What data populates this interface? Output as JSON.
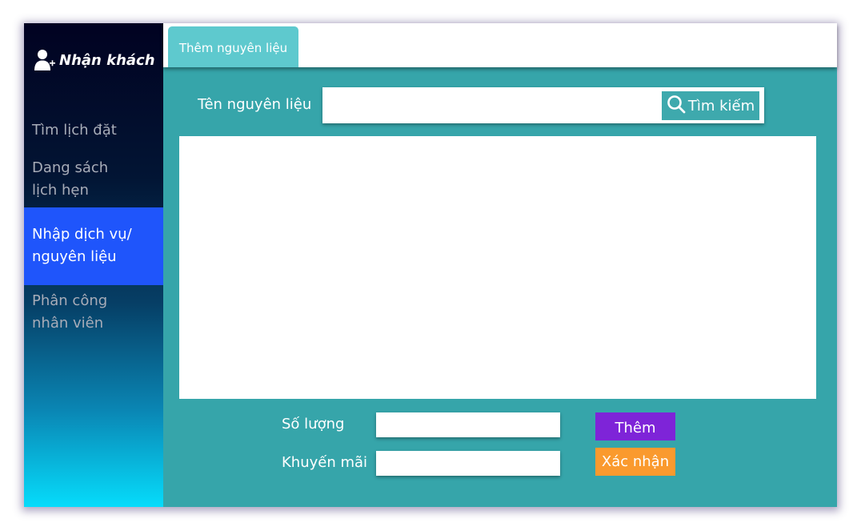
{
  "sidebar": {
    "brand_label": "Nhận khách",
    "brand_icon": "add-user-icon",
    "items": [
      {
        "label": "Tìm lịch đặt"
      },
      {
        "line1": "Dang sách",
        "line2": "lịch hẹn"
      },
      {
        "line1": "Nhập dịch vụ/",
        "line2": "nguyên liệu",
        "active": true
      },
      {
        "line1": "Phân công",
        "line2": "nhân viên"
      }
    ]
  },
  "tabs": [
    {
      "label": "Thêm nguyên liệu",
      "active": true
    }
  ],
  "search": {
    "label": "Tên nguyên liệu",
    "value": "",
    "button_label": "Tìm kiếm",
    "button_icon": "search-icon"
  },
  "form": {
    "quantity_label": "Số lượng",
    "quantity_value": "",
    "promo_label": "Khuyến mãi",
    "promo_value": "",
    "add_label": "Thêm",
    "confirm_label": "Xác nhận"
  },
  "colors": {
    "content_bg": "#36a5aa",
    "active_nav": "#1f55fb",
    "tab": "#5ec9ce",
    "add_button": "#7e24d8",
    "confirm_button": "#fa9a2e"
  }
}
